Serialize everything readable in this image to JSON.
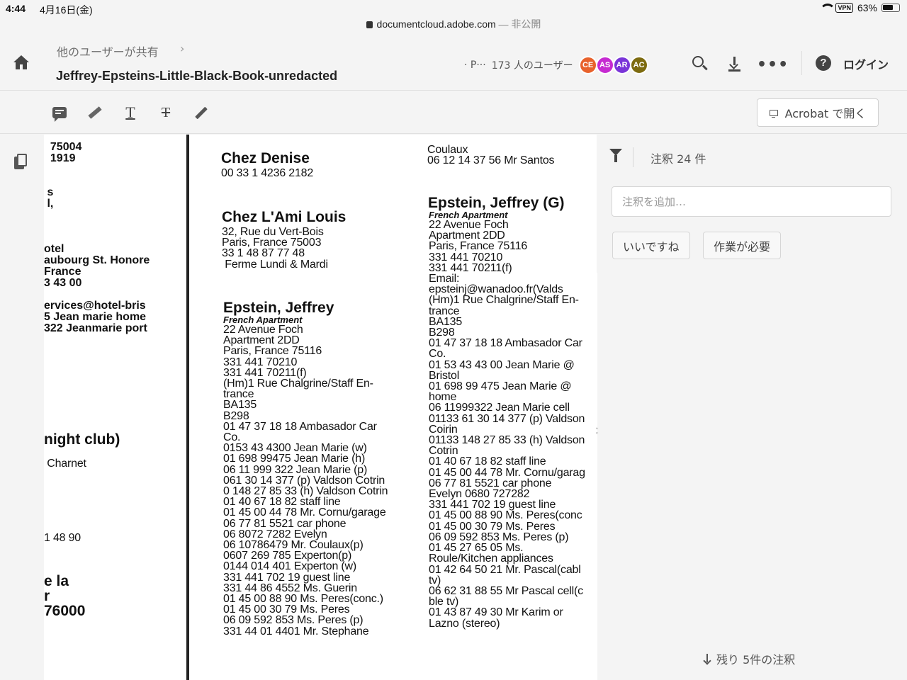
{
  "status_bar": {
    "time": "4:44",
    "date": "4月16日(金)",
    "url": "documentcloud.adobe.com",
    "privacy": " — 非公開",
    "vpn": "VPN",
    "battery": "63%"
  },
  "header": {
    "breadcrumb": "他のユーザーが共有",
    "breadcrumb_chevron": "›",
    "title": "Jeffrey-Epsteins-Little-Black-Book-unredacted",
    "page_label": "· P···",
    "users_count": "173 人のユーザー",
    "avatars": [
      {
        "initials": "CE",
        "color": "#e8622c"
      },
      {
        "initials": "AS",
        "color": "#c62bd1"
      },
      {
        "initials": "AR",
        "color": "#7a35d8"
      },
      {
        "initials": "AC",
        "color": "#7d6b10"
      }
    ],
    "more_label": "•••",
    "help_label": "?",
    "login_label": "ログイン"
  },
  "toolbar": {
    "text_tool": "T",
    "strike_tool": "T",
    "acrobat_label": "Acrobat で開く"
  },
  "document": {
    "left_column": "  75004\n  1919\n\n\n s\n l,\n\n\n\notel\naubourg St. Honore\nFrance\n3 43 00\n\nervices@hotel-bris\n5 Jean marie home\n322 Jeanmarie port",
    "left_column_2": "night club)",
    "left_column_3": " Charnet",
    "left_column_4": "1 48 90",
    "left_column_5": "e la\nr\n76000",
    "col_a": [
      {
        "heading": "Chez Denise",
        "lines": [
          "00 33 1 4236 2182"
        ]
      },
      {
        "heading": "Chez L'Ami Louis",
        "lines": [
          "32, Rue du Vert-Bois",
          "Paris, France 75003",
          "33 1 48 87 77 48",
          " Ferme Lundi & Mardi"
        ]
      },
      {
        "heading": "Epstein, Jeffrey",
        "sub": "French Apartment",
        "lines": [
          "22 Avenue Foch",
          "Apartment 2DD",
          "Paris, France 75116",
          "331 441 70210",
          "331 441 70211(f)",
          "(Hm)1 Rue Chalgrine/Staff En-",
          "trance",
          "BA135",
          "B298",
          "01 47 37 18 18 Ambasador Car",
          "Co.",
          "0153 43 4300 Jean Marie (w)",
          "01 698 99475 Jean Marie (h)",
          "06 11 999 322 Jean Marie (p)",
          "061 30 14 377 (p) Valdson Cotrin",
          "0 148 27 85 33 (h) Valdson Cotrin",
          "01 40 67 18 82 staff line",
          "01 45 00 44 78 Mr. Cornu/garage",
          "06 77 81 5521 car phone",
          "06 8072 7282 Evelyn",
          "06 10786479 Mr. Coulaux(p)",
          "0607 269 785 Experton(p)",
          "0144 014 401 Experton (w)",
          "331 441 702 19 guest line",
          "331 44 86 4552 Ms. Guerin",
          "01 45 00 88 90 Ms. Peres(conc.)",
          "01 45 00 30 79 Ms. Peres",
          "06 09 592 853 Ms. Peres (p)",
          "331 44 01 4401 Mr. Stephane"
        ]
      }
    ],
    "col_b": [
      {
        "lines": [
          "Coulaux",
          "06 12 14 37 56 Mr Santos"
        ]
      },
      {
        "heading": "Epstein, Jeffrey (G)",
        "sub": "French Apartment",
        "lines": [
          "22 Avenue Foch",
          "Apartment 2DD",
          "Paris, France 75116",
          "331 441 70210",
          "331 441 70211(f)",
          "Email:",
          "epsteinj@wanadoo.fr(Valds",
          "(Hm)1 Rue Chalgrine/Staff En-",
          "trance",
          "BA135",
          "B298",
          "01 47 37 18 18 Ambasador Car",
          "Co.",
          "01 53 43 43 00 Jean Marie @",
          "Bristol",
          "01 698 99 475 Jean Marie @",
          "home",
          "06 11999322 Jean Marie cell",
          "01133 61 30 14 377 (p) Valdson",
          "Coirin",
          "01133 148 27 85 33 (h) Valdson",
          "Cotrin",
          "01 40 67 18 82 staff line",
          "01 45 00 44 78 Mr. Cornu/garag",
          "06 77 81 5521 car phone",
          "Evelyn 0680 727282",
          "331 441 702 19 guest line",
          "01 45 00 88 90 Ms. Peres(conc",
          "01 45 00 30 79 Ms. Peres",
          "06 09 592 853 Ms. Peres (p)",
          "01 45 27 65 05 Ms.",
          "Roule/Kitchen appliances",
          "01 42 64 50 21 Mr. Pascal(cabl",
          "tv)",
          "06 62 31 88 55 Mr Pascal cell(c",
          "ble tv)",
          "01 43 87 49 30 Mr Karim or",
          "Lazno (stereo)"
        ]
      }
    ]
  },
  "panel": {
    "comments_count": "注釈 24 件",
    "add_placeholder": "注釈を追加…",
    "chip_like": "いいですね",
    "chip_needs_work": "作業が必要",
    "remaining": "残り 5件の注釈"
  }
}
